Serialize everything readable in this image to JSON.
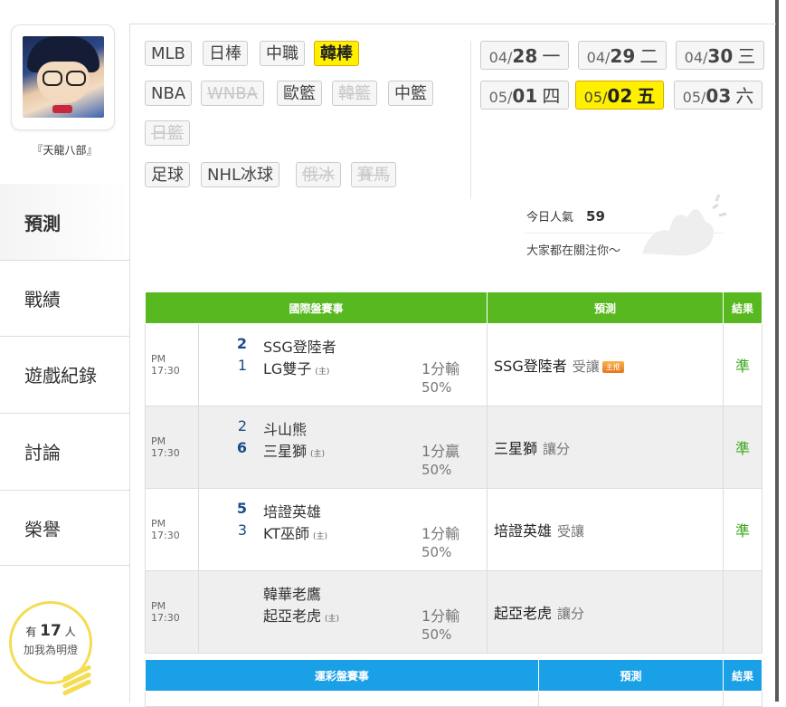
{
  "user": {
    "name": "『天龍八部』"
  },
  "nav": [
    {
      "label": "預測"
    },
    {
      "label": "戰績"
    },
    {
      "label": "遊戲紀錄"
    },
    {
      "label": "討論"
    },
    {
      "label": "榮譽"
    }
  ],
  "fans": {
    "prefix": "有",
    "count": "17",
    "suffix": "人",
    "line2": "加我為明燈"
  },
  "leagues": {
    "row1": [
      "MLB",
      "日棒",
      "中職",
      "韓棒"
    ],
    "row2": [
      "NBA",
      "WNBA",
      "歐籃",
      "韓籃",
      "中籃"
    ],
    "row3": [
      "日籃"
    ],
    "row4": [
      "足球",
      "NHL冰球",
      "俄冰",
      "賽馬"
    ]
  },
  "dates": [
    {
      "md": "04/",
      "d": "28",
      "wd": "一"
    },
    {
      "md": "04/",
      "d": "29",
      "wd": "二"
    },
    {
      "md": "04/",
      "d": "30",
      "wd": "三"
    },
    {
      "md": "05/",
      "d": "01",
      "wd": "四"
    },
    {
      "md": "05/",
      "d": "02",
      "wd": "五"
    },
    {
      "md": "05/",
      "d": "03",
      "wd": "六"
    }
  ],
  "popularity": {
    "label": "今日人氣",
    "value": "59",
    "slogan": "大家都在關注你～"
  },
  "table1": {
    "headers": [
      "國際盤賽事",
      "預測",
      "結果"
    ],
    "rows": [
      {
        "time": "PM 17:30",
        "away_score": "2",
        "away": "SSG登陸者",
        "home_score": "1",
        "home": "LG雙子",
        "home_mark": "(主)",
        "handicap": "1分輸",
        "pct": "50%",
        "pick": "SSG登陸者",
        "pick_type": "受讓",
        "badge": "主推",
        "result": "準"
      },
      {
        "time": "PM 17:30",
        "away_score": "2",
        "away": "斗山熊",
        "home_score": "6",
        "home": "三星獅",
        "home_mark": "(主)",
        "handicap": "1分贏",
        "pct": "50%",
        "pick": "三星獅",
        "pick_type": "讓分",
        "badge": "",
        "result": "準"
      },
      {
        "time": "PM 17:30",
        "away_score": "5",
        "away": "培證英雄",
        "home_score": "3",
        "home": "KT巫師",
        "home_mark": "(主)",
        "handicap": "1分輸",
        "pct": "50%",
        "pick": "培證英雄",
        "pick_type": "受讓",
        "badge": "",
        "result": "準"
      },
      {
        "time": "PM 17:30",
        "away_score": "",
        "away": "韓華老鷹",
        "home_score": "",
        "home": "起亞老虎",
        "home_mark": "(主)",
        "handicap": "1分輸",
        "pct": "50%",
        "pick": "起亞老虎",
        "pick_type": "讓分",
        "badge": "",
        "result": ""
      }
    ]
  },
  "table2": {
    "headers": [
      "運彩盤賽事",
      "預測",
      "結果"
    ]
  },
  "colors": {
    "green_header": "#58b820",
    "blue_header": "#1aa0e6",
    "highlight": "#fff000",
    "win": "#3aa61b"
  }
}
